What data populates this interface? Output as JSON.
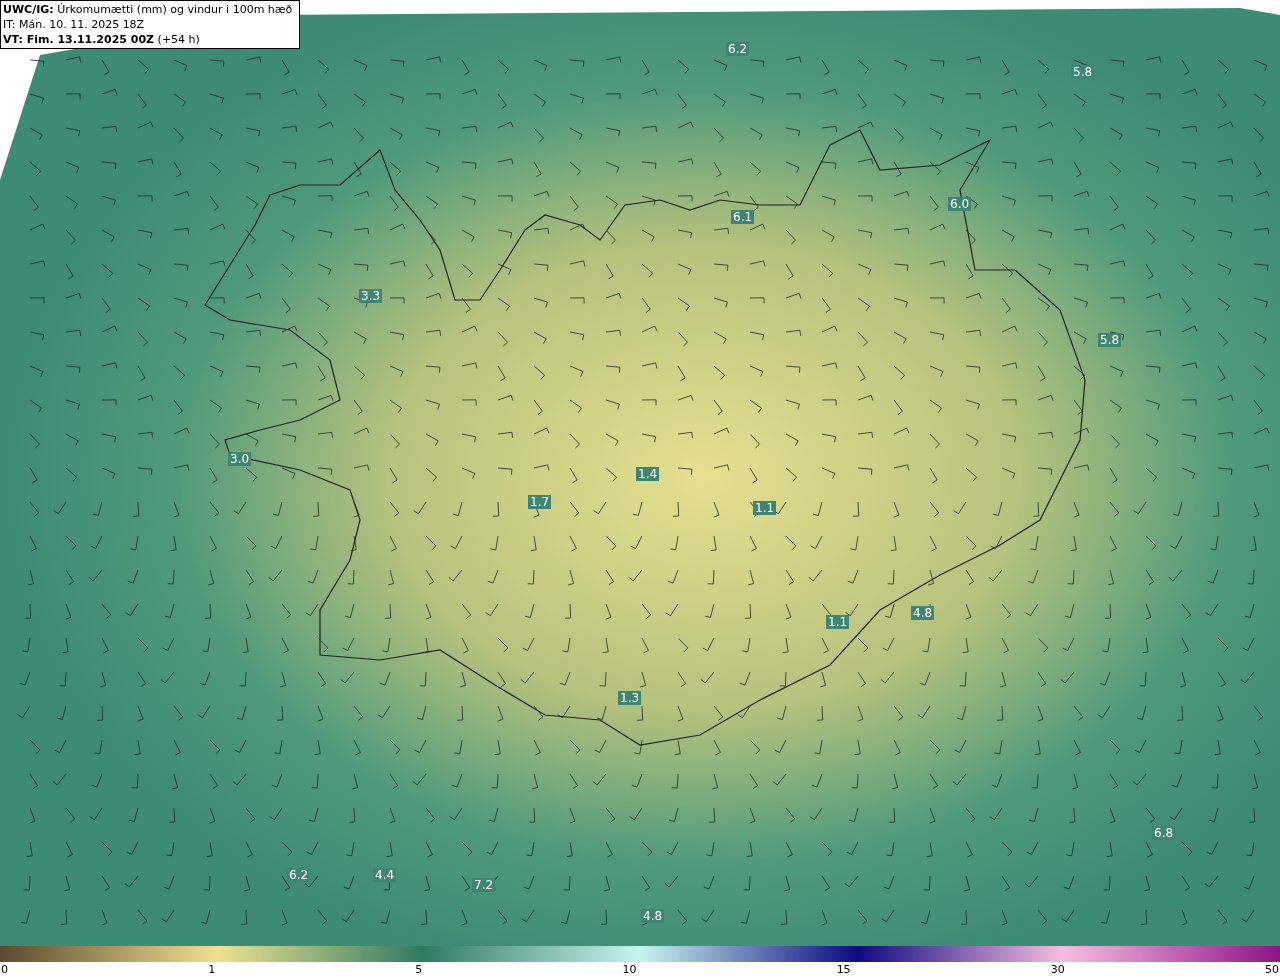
{
  "header": {
    "source": "UWC/IG:",
    "title": "Úrkomumætti (mm) og vindur i 100m hæð",
    "init_time": "IT: Mán. 10. 11. 2025 18Z",
    "valid_time": "VT: Fim. 13.11.2025 00Z",
    "lead": "(+54 h)"
  },
  "map_labels": [
    "6.2",
    "5.8",
    "6.1",
    "6.0",
    "3.3",
    "5.8",
    "3.0",
    "1.7",
    "1.4",
    "1.1",
    "4.8",
    "1.1",
    "1.3",
    "6.8",
    "6.2",
    "4.4",
    "7.2",
    "4.8"
  ],
  "colorbar": {
    "ticks": [
      "0",
      "1",
      "5",
      "10",
      "15",
      "30",
      "50"
    ]
  }
}
